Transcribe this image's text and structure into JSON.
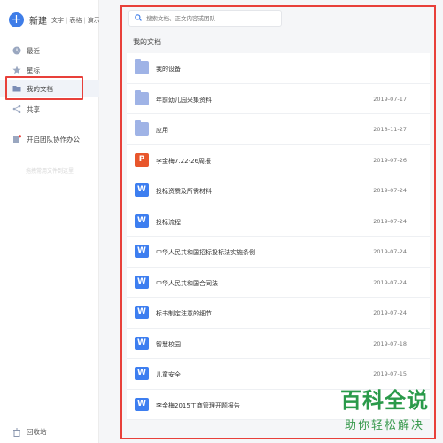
{
  "sidebar": {
    "new_label": "新建",
    "new_types": [
      "文字",
      "表格",
      "演示"
    ],
    "items": [
      {
        "label": "最近",
        "icon": "clock-icon"
      },
      {
        "label": "星标",
        "icon": "star-icon"
      },
      {
        "label": "我的文档",
        "icon": "folder-icon",
        "active": true
      },
      {
        "label": "共享",
        "icon": "share-icon"
      },
      {
        "label": "开启团队协作办公",
        "icon": "team-icon"
      }
    ],
    "divider_text": "拖拽常用文件到这里",
    "trash_label": "回收站"
  },
  "search": {
    "placeholder": "搜索文档、正文内容或团队"
  },
  "main": {
    "section_title": "我的文档",
    "rows": [
      {
        "type": "folder",
        "name": "我的设备",
        "date": ""
      },
      {
        "type": "folder",
        "name": "年前幼儿园采集资料",
        "date": "2019-07-17"
      },
      {
        "type": "folder",
        "name": "应用",
        "date": "2018-11-27"
      },
      {
        "type": "p",
        "name": "李金梅7.22-26周报",
        "date": "2019-07-26"
      },
      {
        "type": "w",
        "name": "投标资质及所需材料",
        "date": "2019-07-24"
      },
      {
        "type": "w",
        "name": "投标流程",
        "date": "2019-07-24"
      },
      {
        "type": "w",
        "name": "中华人民共和国招标投标法实施条例",
        "date": "2019-07-24"
      },
      {
        "type": "w",
        "name": "中华人民共和国合同法",
        "date": "2019-07-24"
      },
      {
        "type": "w",
        "name": "标书制定注意的细节",
        "date": "2019-07-24"
      },
      {
        "type": "w",
        "name": "智慧校园",
        "date": "2019-07-18"
      },
      {
        "type": "w",
        "name": "儿童安全",
        "date": "2019-07-15"
      },
      {
        "type": "w",
        "name": "李金梅2015工商管理开题报告",
        "date": ""
      }
    ]
  },
  "watermark": {
    "title": "百科全说",
    "subtitle": "助你轻松解决"
  },
  "colors": {
    "accent": "#3f7de8",
    "highlight": "#e8403a",
    "word": "#3d7ef0",
    "ppt": "#e8562c",
    "folder": "#9fb3e6"
  }
}
